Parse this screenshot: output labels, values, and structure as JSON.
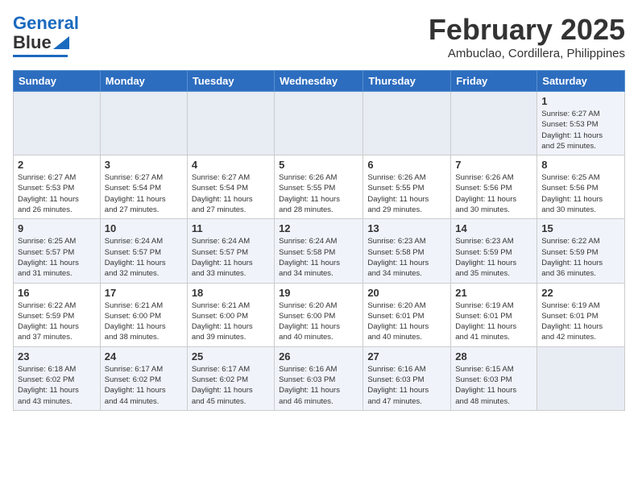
{
  "logo": {
    "text1": "General",
    "text2": "Blue"
  },
  "title": "February 2025",
  "subtitle": "Ambuclao, Cordillera, Philippines",
  "days": [
    "Sunday",
    "Monday",
    "Tuesday",
    "Wednesday",
    "Thursday",
    "Friday",
    "Saturday"
  ],
  "weeks": [
    [
      {
        "num": "",
        "info": ""
      },
      {
        "num": "",
        "info": ""
      },
      {
        "num": "",
        "info": ""
      },
      {
        "num": "",
        "info": ""
      },
      {
        "num": "",
        "info": ""
      },
      {
        "num": "",
        "info": ""
      },
      {
        "num": "1",
        "info": "Sunrise: 6:27 AM\nSunset: 5:53 PM\nDaylight: 11 hours\nand 25 minutes."
      }
    ],
    [
      {
        "num": "2",
        "info": "Sunrise: 6:27 AM\nSunset: 5:53 PM\nDaylight: 11 hours\nand 26 minutes."
      },
      {
        "num": "3",
        "info": "Sunrise: 6:27 AM\nSunset: 5:54 PM\nDaylight: 11 hours\nand 27 minutes."
      },
      {
        "num": "4",
        "info": "Sunrise: 6:27 AM\nSunset: 5:54 PM\nDaylight: 11 hours\nand 27 minutes."
      },
      {
        "num": "5",
        "info": "Sunrise: 6:26 AM\nSunset: 5:55 PM\nDaylight: 11 hours\nand 28 minutes."
      },
      {
        "num": "6",
        "info": "Sunrise: 6:26 AM\nSunset: 5:55 PM\nDaylight: 11 hours\nand 29 minutes."
      },
      {
        "num": "7",
        "info": "Sunrise: 6:26 AM\nSunset: 5:56 PM\nDaylight: 11 hours\nand 30 minutes."
      },
      {
        "num": "8",
        "info": "Sunrise: 6:25 AM\nSunset: 5:56 PM\nDaylight: 11 hours\nand 30 minutes."
      }
    ],
    [
      {
        "num": "9",
        "info": "Sunrise: 6:25 AM\nSunset: 5:57 PM\nDaylight: 11 hours\nand 31 minutes."
      },
      {
        "num": "10",
        "info": "Sunrise: 6:24 AM\nSunset: 5:57 PM\nDaylight: 11 hours\nand 32 minutes."
      },
      {
        "num": "11",
        "info": "Sunrise: 6:24 AM\nSunset: 5:57 PM\nDaylight: 11 hours\nand 33 minutes."
      },
      {
        "num": "12",
        "info": "Sunrise: 6:24 AM\nSunset: 5:58 PM\nDaylight: 11 hours\nand 34 minutes."
      },
      {
        "num": "13",
        "info": "Sunrise: 6:23 AM\nSunset: 5:58 PM\nDaylight: 11 hours\nand 34 minutes."
      },
      {
        "num": "14",
        "info": "Sunrise: 6:23 AM\nSunset: 5:59 PM\nDaylight: 11 hours\nand 35 minutes."
      },
      {
        "num": "15",
        "info": "Sunrise: 6:22 AM\nSunset: 5:59 PM\nDaylight: 11 hours\nand 36 minutes."
      }
    ],
    [
      {
        "num": "16",
        "info": "Sunrise: 6:22 AM\nSunset: 5:59 PM\nDaylight: 11 hours\nand 37 minutes."
      },
      {
        "num": "17",
        "info": "Sunrise: 6:21 AM\nSunset: 6:00 PM\nDaylight: 11 hours\nand 38 minutes."
      },
      {
        "num": "18",
        "info": "Sunrise: 6:21 AM\nSunset: 6:00 PM\nDaylight: 11 hours\nand 39 minutes."
      },
      {
        "num": "19",
        "info": "Sunrise: 6:20 AM\nSunset: 6:00 PM\nDaylight: 11 hours\nand 40 minutes."
      },
      {
        "num": "20",
        "info": "Sunrise: 6:20 AM\nSunset: 6:01 PM\nDaylight: 11 hours\nand 40 minutes."
      },
      {
        "num": "21",
        "info": "Sunrise: 6:19 AM\nSunset: 6:01 PM\nDaylight: 11 hours\nand 41 minutes."
      },
      {
        "num": "22",
        "info": "Sunrise: 6:19 AM\nSunset: 6:01 PM\nDaylight: 11 hours\nand 42 minutes."
      }
    ],
    [
      {
        "num": "23",
        "info": "Sunrise: 6:18 AM\nSunset: 6:02 PM\nDaylight: 11 hours\nand 43 minutes."
      },
      {
        "num": "24",
        "info": "Sunrise: 6:17 AM\nSunset: 6:02 PM\nDaylight: 11 hours\nand 44 minutes."
      },
      {
        "num": "25",
        "info": "Sunrise: 6:17 AM\nSunset: 6:02 PM\nDaylight: 11 hours\nand 45 minutes."
      },
      {
        "num": "26",
        "info": "Sunrise: 6:16 AM\nSunset: 6:03 PM\nDaylight: 11 hours\nand 46 minutes."
      },
      {
        "num": "27",
        "info": "Sunrise: 6:16 AM\nSunset: 6:03 PM\nDaylight: 11 hours\nand 47 minutes."
      },
      {
        "num": "28",
        "info": "Sunrise: 6:15 AM\nSunset: 6:03 PM\nDaylight: 11 hours\nand 48 minutes."
      },
      {
        "num": "",
        "info": ""
      }
    ]
  ]
}
